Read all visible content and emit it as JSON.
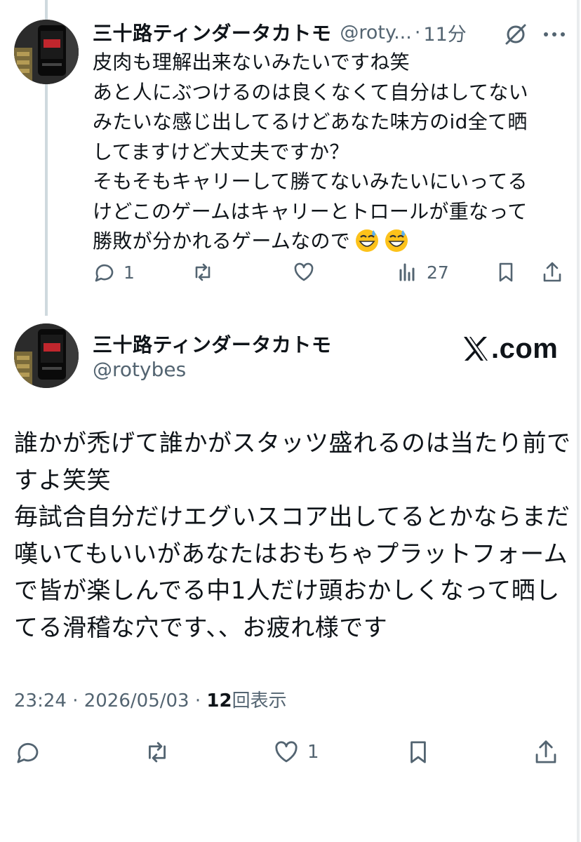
{
  "reply": {
    "display_name": "三十路ティンダータカトモ",
    "handle": "@roty...",
    "separator": "·",
    "time": "11分",
    "body_lines": [
      "皮肉も理解出来ないみたいですね笑",
      "あと人にぶつけるのは良くなくて自分はしてない",
      "みたいな感じ出してるけどあなた味方のid全て晒",
      "してますけど大丈夫ですか？",
      "そもそもキャリーして勝てないみたいにいってる",
      "けどこのゲームはキャリーとトロールが重なって",
      "勝敗が分かれるゲームなので"
    ],
    "emojis": [
      "grinning-sweat",
      "grinning-sweat"
    ],
    "actions": {
      "reply_count": "1",
      "views_count": "27"
    }
  },
  "main": {
    "display_name": "三十路ティンダータカトモ",
    "handle": "@rotybes",
    "brand_suffix": ".com",
    "body_lines": [
      "誰かが禿げて誰かがスタッツ盛れるのは当たり前で",
      "すよ笑笑",
      "毎試合自分だけエグいスコア出してるとかならまだ",
      "嘆いてもいいがあなたはおもちゃプラットフォーム",
      "で皆が楽しんでる中1人だけ頭おかしくなって晒し",
      "てる滑稽な穴です、、お疲れ様です"
    ],
    "meta": {
      "timestamp": "23:24 · 2026/05/03 · ",
      "views_number": "12",
      "views_label": "回表示"
    },
    "actions": {
      "like_count": "1"
    }
  },
  "colors": {
    "text": "#0f1419",
    "secondary": "#536471",
    "thread_line": "#cfd9de"
  }
}
